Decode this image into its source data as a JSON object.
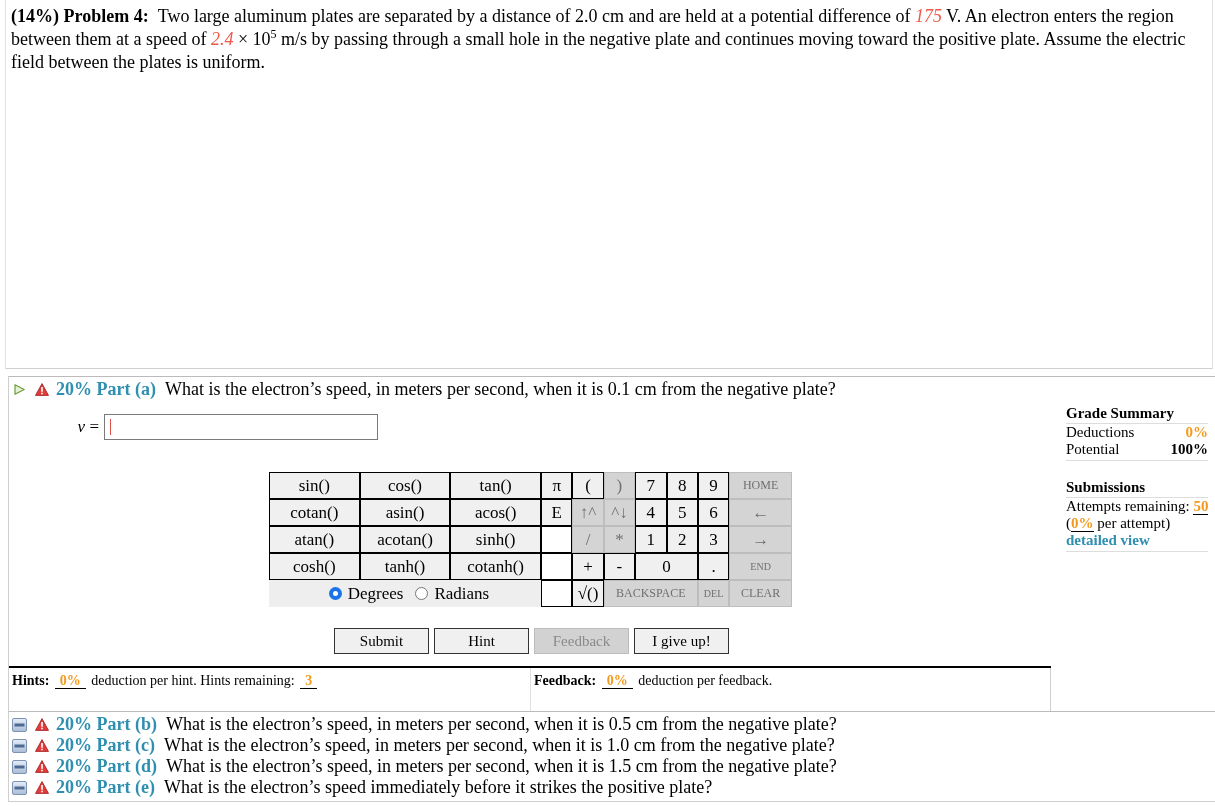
{
  "problem": {
    "heading": "(14%) Problem 4:",
    "segments": [
      {
        "kind": "text",
        "text": "Two large aluminum plates are separated by a distance of 2.0 cm and are held at a potential difference of "
      },
      {
        "kind": "given",
        "text": "175"
      },
      {
        "kind": "text",
        "text": " V. An electron enters the region between them at a speed of "
      },
      {
        "kind": "given",
        "text": "2.4"
      },
      {
        "kind": "text",
        "text": " × 10$^{5}$ m/s by passing through a small hole in the negative plate and continues moving toward the positive plate. Assume the electric field between the plates is uniform."
      }
    ]
  },
  "parts": [
    {
      "title": "20% Part (a)",
      "question": "What is the electron’s speed, in meters per second, when it is 0.1 cm from the negative plate?",
      "expanded": true
    },
    {
      "title": "20% Part (b)",
      "question": "What is the electron’s speed, in meters per second, when it is 0.5 cm from the negative plate?",
      "expanded": false
    },
    {
      "title": "20% Part (c)",
      "question": "What is the electron’s speed, in meters per second, when it is 1.0 cm from the negative plate?",
      "expanded": false
    },
    {
      "title": "20% Part (d)",
      "question": "What is the electron’s speed, in meters per second, when it is 1.5 cm from the negative plate?",
      "expanded": false
    },
    {
      "title": "20% Part (e)",
      "question": "What is the electron’s speed immediately before it strikes the positive plate?",
      "expanded": false
    }
  ],
  "work": {
    "answer": {
      "variable": "*v* =",
      "focused": true
    },
    "keypad": {
      "functions": [
        [
          "sin()",
          "cos()",
          "tan()"
        ],
        [
          "cotan()",
          "asin()",
          "acos()"
        ],
        [
          "atan()",
          "acotan()",
          "sinh()"
        ],
        [
          "cosh()",
          "tanh()",
          "cotanh()"
        ]
      ],
      "angle_modes": [
        {
          "label": "Degrees",
          "selected": true
        },
        {
          "label": "Radians",
          "selected": false
        }
      ],
      "keys": [
        [
          {
            "kind": "key",
            "label": "π",
            "disabled": false
          },
          {
            "kind": "key",
            "label": "(",
            "disabled": false
          },
          {
            "kind": "key",
            "label": ")",
            "disabled": true
          },
          {
            "kind": "key",
            "label": "7",
            "disabled": false
          },
          {
            "kind": "key",
            "label": "8",
            "disabled": false
          },
          {
            "kind": "key",
            "label": "9",
            "disabled": false
          },
          {
            "kind": "command",
            "label": "HOME",
            "disabled": true
          }
        ],
        [
          {
            "kind": "key",
            "label": "E",
            "disabled": false
          },
          {
            "kind": "key",
            "label": "↑^",
            "disabled": true
          },
          {
            "kind": "key",
            "label": "^↓",
            "disabled": true
          },
          {
            "kind": "key",
            "label": "4",
            "disabled": false
          },
          {
            "kind": "key",
            "label": "5",
            "disabled": false
          },
          {
            "kind": "key",
            "label": "6",
            "disabled": false
          },
          {
            "kind": "key",
            "label": "←",
            "disabled": true
          }
        ],
        [
          {
            "kind": "blank",
            "disabled": false
          },
          {
            "kind": "key",
            "label": "/",
            "disabled": true
          },
          {
            "kind": "key",
            "label": "*",
            "disabled": true
          },
          {
            "kind": "key",
            "label": "1",
            "disabled": false
          },
          {
            "kind": "key",
            "label": "2",
            "disabled": false
          },
          {
            "kind": "key",
            "label": "3",
            "disabled": false
          },
          {
            "kind": "key",
            "label": "→",
            "disabled": true
          }
        ],
        [
          {
            "kind": "blank",
            "disabled": false
          },
          {
            "kind": "key",
            "label": "+",
            "disabled": false
          },
          {
            "kind": "key",
            "label": "-",
            "disabled": false
          },
          {
            "kind": "key",
            "label": "0",
            "disabled": false
          },
          {
            "kind": "key",
            "label": ".",
            "disabled": false
          },
          {
            "kind": "command",
            "label": "END",
            "disabled": true
          }
        ],
        [
          {
            "kind": "blank",
            "disabled": false
          },
          {
            "kind": "key",
            "label": "√()",
            "disabled": false
          },
          {
            "kind": "command",
            "label": "BACKSPACE",
            "disabled": true
          },
          {
            "kind": "command",
            "label": "DEL",
            "disabled": true
          },
          {
            "kind": "command",
            "label": "CLEAR",
            "disabled": true
          }
        ]
      ]
    },
    "buttons": [
      {
        "label": "Submit",
        "disabled": false
      },
      {
        "label": "Hint",
        "disabled": false
      },
      {
        "label": "Feedback",
        "disabled": true
      },
      {
        "label": "I give up!",
        "disabled": false
      }
    ],
    "hints": {
      "label": "Hints:",
      "value": "0%",
      "text": "deduction per hint. Hints remaining:",
      "remaining": "3"
    },
    "feedback": {
      "label": "Feedback:",
      "value": "0%",
      "text": "deduction per feedback."
    }
  },
  "grade_summary": {
    "title": "Grade Summary",
    "rows": [
      {
        "label": "Deductions",
        "value": "0%",
        "kind": "deduction"
      },
      {
        "label": "Potential",
        "value": "100%",
        "kind": "total"
      }
    ]
  },
  "submissions": {
    "title": "Submissions",
    "attempts_label": "Attempts remaining:",
    "attempts": "50",
    "per_attempt": {
      "before": "(",
      "value": "0%",
      "after": " per attempt)"
    },
    "link": "detailed view"
  }
}
